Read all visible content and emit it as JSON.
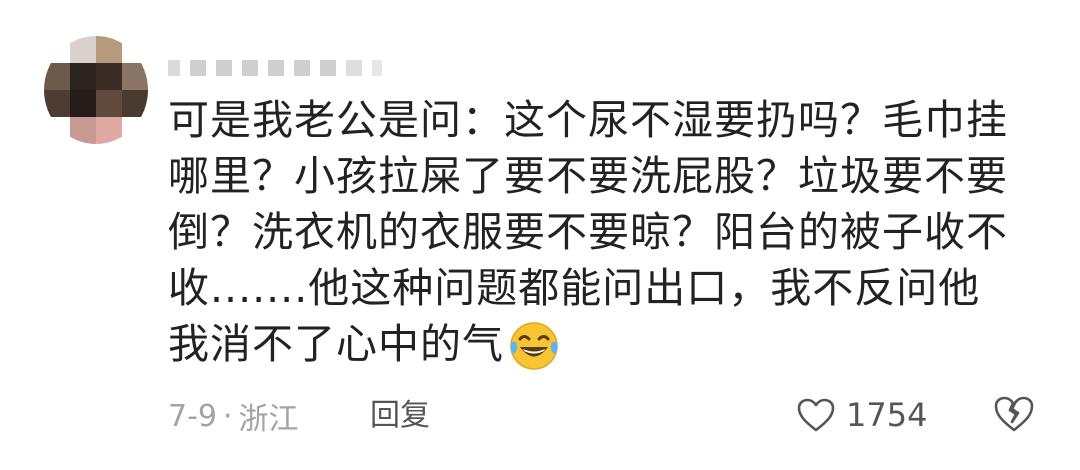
{
  "comment": {
    "username": "",
    "text": "可是我老公是问：这个尿不湿要扔吗？毛巾挂哪里？小孩拉屎了要不要洗屁股？垃圾要不要倒？洗衣机的衣服要不要晾？阳台的被子收不收.......他这种问题都能问出口，我不反问他我消不了心中的气",
    "emoji": "laughing-with-tears",
    "date": "7-9",
    "separator": "·",
    "location": "浙江",
    "reply_label": "回复",
    "like_count": "1754"
  },
  "colors": {
    "text": "#222222",
    "meta": "#a3a3a3",
    "action": "#555555",
    "emoji_face": "#f7c433"
  }
}
